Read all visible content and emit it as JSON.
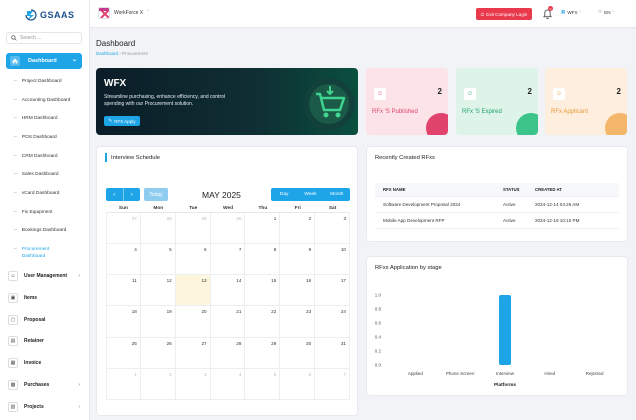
{
  "brand": {
    "name": "GSAAS"
  },
  "sidebar": {
    "search_placeholder": "Search ...",
    "active": {
      "label": "Dashboard"
    },
    "sub_items": [
      {
        "label": "Project Dashboard"
      },
      {
        "label": "Accounting Dashboard"
      },
      {
        "label": "HRM Dashboard"
      },
      {
        "label": "POS Dashboard"
      },
      {
        "label": "CRM Dashboard"
      },
      {
        "label": "Sales Dashboard"
      },
      {
        "label": "vCard Dashboard"
      },
      {
        "label": "Fix Equipment"
      },
      {
        "label": "Bookings Dashboard"
      },
      {
        "label": "Procurement Dashboard"
      }
    ],
    "main_items": [
      {
        "label": "User Management",
        "has_children": true,
        "icon": "users-icon"
      },
      {
        "label": "Items",
        "has_children": false,
        "icon": "box-icon"
      },
      {
        "label": "Proposal",
        "has_children": false,
        "icon": "file-icon"
      },
      {
        "label": "Retainer",
        "has_children": false,
        "icon": "receipt-icon"
      },
      {
        "label": "Invoice",
        "has_children": false,
        "icon": "invoice-icon"
      },
      {
        "label": "Purchases",
        "has_children": true,
        "icon": "cart-icon"
      },
      {
        "label": "Projects",
        "has_children": true,
        "icon": "folder-icon"
      }
    ]
  },
  "topbar": {
    "workspace": "WorkForce X",
    "exit_label": "Exit Company Login",
    "notification_count": "0",
    "company": "WFX",
    "language": "EN"
  },
  "page": {
    "title": "Dashboard",
    "breadcrumb_home": "Dashboard",
    "breadcrumb_current": "Procurement"
  },
  "hero": {
    "title": "WFX",
    "description": "Streamline purchasing, enhance efficiency, and control spending with our Procurement solution.",
    "button": "RFX Apply"
  },
  "stats": [
    {
      "label": "RFx 'S Published",
      "count": "2",
      "color": "#e0436b",
      "bg": "#fbe3e8",
      "blob": "#e0436b"
    },
    {
      "label": "RFx 'S Expired",
      "count": "2",
      "color": "#1ea36c",
      "bg": "#def4e9",
      "blob": "#3cc48a"
    },
    {
      "label": "RFx Applicant",
      "count": "2",
      "color": "#e89a3c",
      "bg": "#fdeedd",
      "blob": "#f4b66a"
    }
  ],
  "calendar": {
    "title": "Interview Schedule",
    "today_label": "Today",
    "month": "MAY 2025",
    "views": [
      "Day",
      "Week",
      "Month"
    ],
    "weekdays": [
      "Sun",
      "Mon",
      "Tue",
      "Wed",
      "Thu",
      "Fri",
      "Sat"
    ],
    "days": [
      {
        "d": "27",
        "o": true
      },
      {
        "d": "28",
        "o": true
      },
      {
        "d": "29",
        "o": true
      },
      {
        "d": "30",
        "o": true
      },
      {
        "d": "1"
      },
      {
        "d": "2"
      },
      {
        "d": "3"
      },
      {
        "d": "4"
      },
      {
        "d": "5"
      },
      {
        "d": "6"
      },
      {
        "d": "7"
      },
      {
        "d": "8"
      },
      {
        "d": "9"
      },
      {
        "d": "10"
      },
      {
        "d": "11"
      },
      {
        "d": "12"
      },
      {
        "d": "13",
        "t": true
      },
      {
        "d": "14"
      },
      {
        "d": "15"
      },
      {
        "d": "16"
      },
      {
        "d": "17"
      },
      {
        "d": "18"
      },
      {
        "d": "19"
      },
      {
        "d": "20"
      },
      {
        "d": "21"
      },
      {
        "d": "22"
      },
      {
        "d": "23"
      },
      {
        "d": "24"
      },
      {
        "d": "25"
      },
      {
        "d": "26"
      },
      {
        "d": "27"
      },
      {
        "d": "28"
      },
      {
        "d": "29"
      },
      {
        "d": "30"
      },
      {
        "d": "31"
      },
      {
        "d": "1",
        "o": true
      },
      {
        "d": "2",
        "o": true
      },
      {
        "d": "3",
        "o": true
      },
      {
        "d": "4",
        "o": true
      },
      {
        "d": "5",
        "o": true
      },
      {
        "d": "6",
        "o": true
      },
      {
        "d": "7",
        "o": true
      }
    ]
  },
  "rfx_table": {
    "title": "Recently Created RFxs",
    "headers": [
      "RFX NAME",
      "STATUS",
      "CREATED AT"
    ],
    "rows": [
      [
        "Software Development Proposal 2024",
        "Active",
        "2024-12-14 04:26 AM"
      ],
      [
        "Mobile App Development RFP",
        "Active",
        "2024-12-16 10:10 PM"
      ]
    ]
  },
  "chart_data": {
    "type": "bar",
    "title": "RFxs Application by stage",
    "categories": [
      "Applied",
      "Phone Screen",
      "Interview",
      "Hired",
      "Rejected"
    ],
    "values": [
      0,
      0,
      1,
      0,
      0
    ],
    "xlabel": "Platforms",
    "ylabel": "",
    "ylim": [
      0,
      1
    ],
    "yticks": [
      "0.0",
      "0.2",
      "0.4",
      "0.6",
      "0.8",
      "1.0"
    ],
    "bar_color": "#1ea5e8",
    "grid": false
  }
}
